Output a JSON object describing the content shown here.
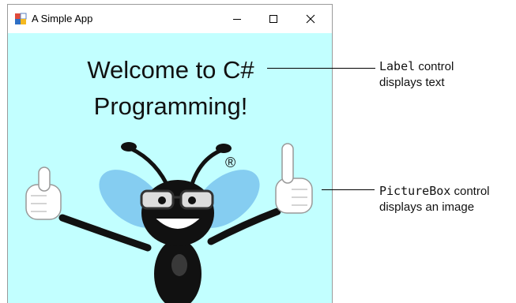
{
  "window": {
    "title": "A Simple App",
    "controls": {
      "minimize": "minimize-icon",
      "maximize": "maximize-icon",
      "close": "close-icon"
    }
  },
  "label": {
    "line1": "Welcome to C#",
    "line2": "Programming!"
  },
  "picture": {
    "registered_mark": "®"
  },
  "callouts": {
    "label_callout": {
      "control": "Label",
      "rest": " control",
      "line2": "displays text"
    },
    "picturebox_callout": {
      "control": "PictureBox",
      "rest": " control",
      "line2": "displays an image"
    }
  },
  "colors": {
    "form_background": "#c2ffff",
    "titlebar": "#ffffff"
  }
}
